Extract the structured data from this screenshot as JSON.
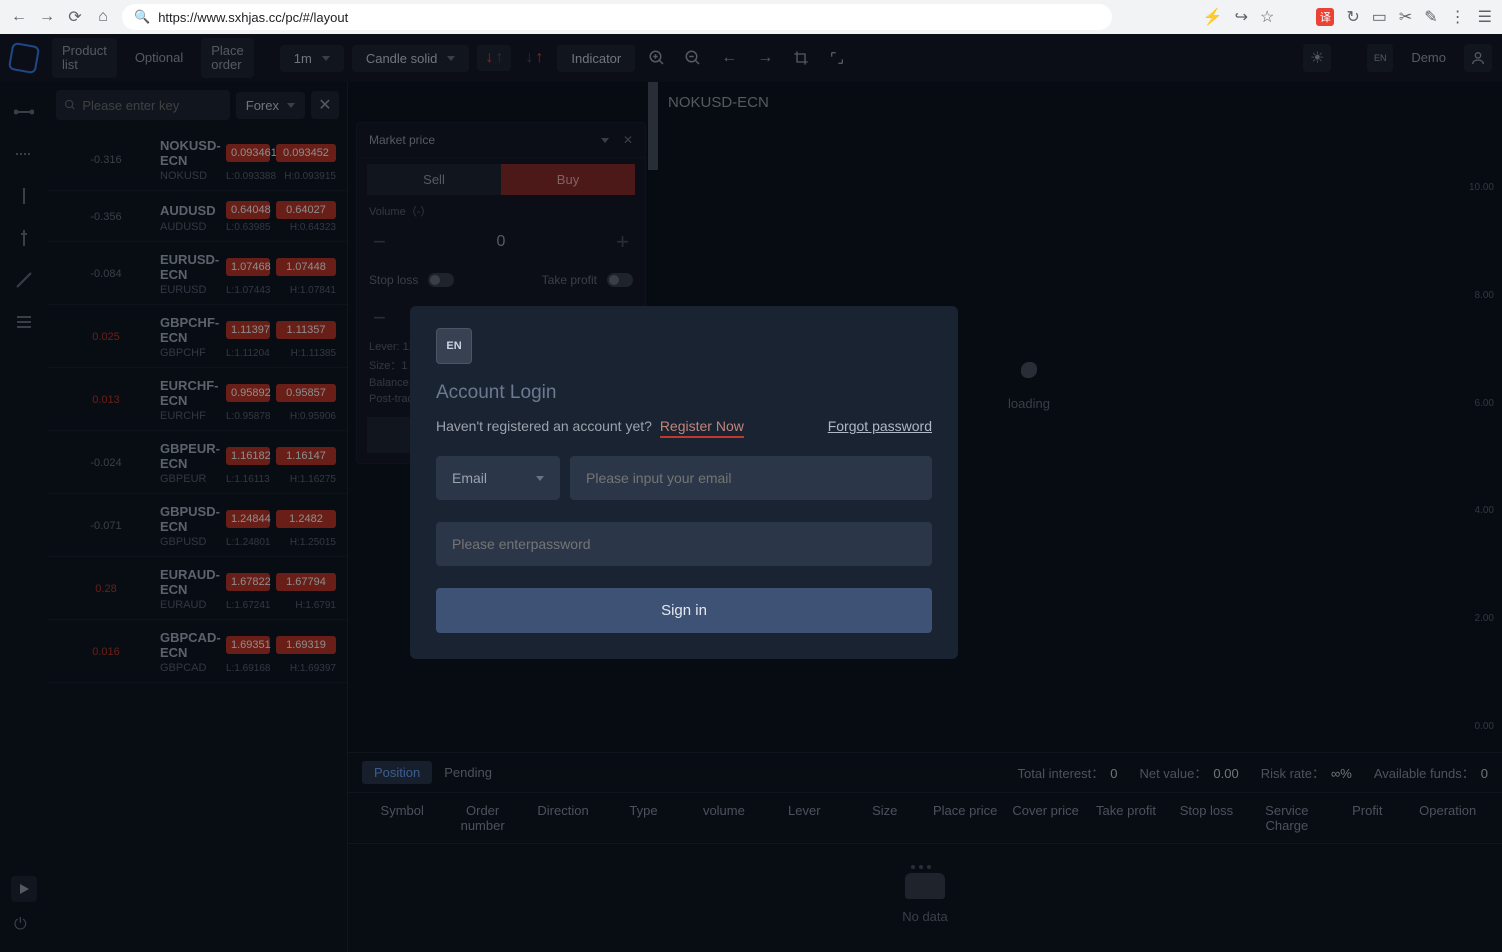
{
  "browser": {
    "url": "https://www.sxhjas.cc/pc/#/layout"
  },
  "topbar": {
    "product_list": "Product\nlist",
    "optional": "Optional",
    "place_order": "Place\norder",
    "timeframe": "1m",
    "candle": "Candle solid",
    "indicator": "Indicator",
    "demo": "Demo"
  },
  "sidebar": {
    "search_placeholder": "Please enter key",
    "category": "Forex",
    "pairs": [
      {
        "name": "NOKUSD-ECN",
        "sub": "NOKUSD",
        "bid": "0.093461",
        "ask": "0.093452",
        "pct": "-0.316",
        "low": "L:0.093388",
        "high": "H:0.093915",
        "dir": "neg"
      },
      {
        "name": "AUDUSD",
        "sub": "AUDUSD",
        "bid": "0.64048",
        "ask": "0.64027",
        "pct": "-0.356",
        "low": "L:0.63985",
        "high": "H:0.64323",
        "dir": "neg"
      },
      {
        "name": "EURUSD-ECN",
        "sub": "EURUSD",
        "bid": "1.07468",
        "ask": "1.07448",
        "pct": "-0.084",
        "low": "L:1.07443",
        "high": "H:1.07841",
        "dir": "neg"
      },
      {
        "name": "GBPCHF-ECN",
        "sub": "GBPCHF",
        "bid": "1.11397",
        "ask": "1.11357",
        "pct": "0.025",
        "low": "L:1.11204",
        "high": "H:1.11385",
        "dir": "pos"
      },
      {
        "name": "EURCHF-ECN",
        "sub": "EURCHF",
        "bid": "0.95892",
        "ask": "0.95857",
        "pct": "0.013",
        "low": "L:0.95878",
        "high": "H:0.95906",
        "dir": "pos"
      },
      {
        "name": "GBPEUR-ECN",
        "sub": "GBPEUR",
        "bid": "1.16182",
        "ask": "1.16147",
        "pct": "-0.024",
        "low": "L:1.16113",
        "high": "H:1.16275",
        "dir": "neg"
      },
      {
        "name": "GBPUSD-ECN",
        "sub": "GBPUSD",
        "bid": "1.24844",
        "ask": "1.2482",
        "pct": "-0.071",
        "low": "L:1.24801",
        "high": "H:1.25015",
        "dir": "neg"
      },
      {
        "name": "EURAUD-ECN",
        "sub": "EURAUD",
        "bid": "1.67822",
        "ask": "1.67794",
        "pct": "0.28",
        "low": "L:1.67241",
        "high": "H:1.6791",
        "dir": "pos"
      },
      {
        "name": "GBPCAD-ECN",
        "sub": "GBPCAD",
        "bid": "1.69351",
        "ask": "1.69319",
        "pct": "0.016",
        "low": "L:1.69168",
        "high": "H:1.69397",
        "dir": "pos"
      }
    ]
  },
  "order_panel": {
    "type": "Market price",
    "sell": "Sell",
    "buy": "Buy",
    "volume_label": "Volume（-）",
    "volume_value": "0",
    "stop_loss": "Stop loss",
    "take_profit": "Take profit",
    "lever": "Lever: 1X",
    "size": "Size：1",
    "balance": "Balance:",
    "post": "Post-trad"
  },
  "chart": {
    "title": "NOKUSD-ECN",
    "loading": "loading",
    "ylabels": [
      "10.00",
      "8.00",
      "6.00",
      "4.00",
      "2.00",
      "0.00"
    ]
  },
  "positions": {
    "tab_position": "Position",
    "tab_pending": "Pending",
    "stats": {
      "interest_label": "Total interest：",
      "interest_val": "0",
      "net_label": "Net value：",
      "net_val": "0.00",
      "risk_label": "Risk rate：",
      "risk_val": "∞%",
      "avail_label": "Available funds：",
      "avail_val": "0"
    },
    "columns": [
      "Symbol",
      "Order number",
      "Direction",
      "Type",
      "volume",
      "Lever",
      "Size",
      "Place price",
      "Cover price",
      "Take profit",
      "Stop loss",
      "Service Charge",
      "Profit",
      "Operation"
    ],
    "no_data": "No data"
  },
  "modal": {
    "lang": "EN",
    "title": "Account Login",
    "noacct": "Haven't registered an account yet?",
    "register": "Register Now",
    "forgot": "Forgot password",
    "id_type": "Email",
    "email_placeholder": "Please input your email",
    "password_placeholder": "Please enterpassword",
    "signin": "Sign in"
  }
}
